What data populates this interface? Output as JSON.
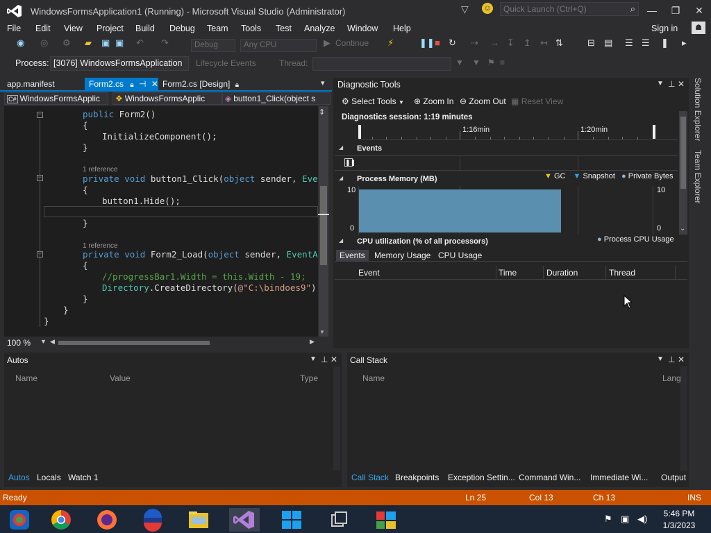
{
  "window": {
    "title": "WindowsFormsApplication1 (Running) - Microsoft Visual Studio (Administrator)",
    "quick_launch_placeholder": "Quick Launch (Ctrl+Q)",
    "minimize": "—",
    "maximize": "❐",
    "close": "✕"
  },
  "menu": {
    "items": [
      "File",
      "Edit",
      "View",
      "Project",
      "Build",
      "Debug",
      "Team",
      "Tools",
      "Test",
      "Analyze",
      "Window",
      "Help"
    ],
    "sign_in": "Sign in"
  },
  "toolbar": {
    "config": "Debug",
    "platform": "Any CPU",
    "continue": "Continue"
  },
  "process_bar": {
    "label": "Process:",
    "process": "[3076] WindowsFormsApplication",
    "lifecycle": "Lifecycle Events",
    "thread_label": "Thread:"
  },
  "editor": {
    "tabs": [
      "app.manifest",
      "Form2.cs",
      "Form2.cs [Design]"
    ],
    "nav": [
      "WindowsFormsApplic",
      "WindowsFormsApplic",
      "button1_Click(object s"
    ],
    "zoom": "100 %",
    "code": {
      "l1_kw": "public",
      "l1_rest": " Form2()",
      "l2": "{",
      "l3": "InitializeComponent();",
      "l4": "}",
      "ref1": "1 reference",
      "l5_kw1": "private",
      "l5_kw2": "void",
      "l5_name": "button1_Click(",
      "l5_kw3": "object",
      "l5_mid": " sender, ",
      "l5_ty": "EventAr",
      "l6": "{",
      "l7": "button1.Hide();",
      "l8": "}",
      "ref2": "1 reference",
      "l9_kw1": "private",
      "l9_kw2": "void",
      "l9_name": "Form2_Load(",
      "l9_kw3": "object",
      "l9_mid": " sender, ",
      "l9_ty": "EventArgs",
      "l10": "{",
      "l11": "//progressBar1.Width = this.Width - 19;",
      "l12_ty": "Directory",
      "l12_mid": ".CreateDirectory(",
      "l12_str": "@\"C:\\bindoes9\"",
      "l12_end": ");",
      "l13": "}",
      "l14": "}",
      "l15": "}"
    }
  },
  "diagnostics": {
    "title": "Diagnostic Tools",
    "select_tools": "Select Tools",
    "zoom_in": "Zoom In",
    "zoom_out": "Zoom Out",
    "reset_view": "Reset View",
    "session": "Diagnostics session: 1:19 minutes",
    "time_labels": [
      "1:16min",
      "1:20min"
    ],
    "events_section": "Events",
    "memory_section": "Process Memory (MB)",
    "memory_legend": [
      "GC",
      "Snapshot",
      "Private Bytes"
    ],
    "memory_y_max": "10",
    "memory_y_min": "0",
    "memory_fill_fraction": 0.69,
    "cpu_section": "CPU utilization (% of all processors)",
    "cpu_legend": "Process CPU Usage",
    "tabs": [
      "Events",
      "Memory Usage",
      "CPU Usage"
    ],
    "columns": [
      "Event",
      "Time",
      "Duration",
      "Thread"
    ],
    "colors": {
      "memory_fill": "#5b8fb0",
      "gc_marker": "#e8c22a",
      "snapshot_marker": "#3aa0e9",
      "private_bytes": "#8ab8d8"
    }
  },
  "autos": {
    "title": "Autos",
    "columns": [
      "Name",
      "Value",
      "Type"
    ],
    "tabs": [
      "Autos",
      "Locals",
      "Watch 1"
    ]
  },
  "callstack": {
    "title": "Call Stack",
    "columns": [
      "Name",
      "Lang"
    ],
    "tabs": [
      "Call Stack",
      "Breakpoints",
      "Exception Settin...",
      "Command Win...",
      "Immediate Wi...",
      "Output"
    ]
  },
  "side_tabs": [
    "Solution Explorer",
    "Team Explorer"
  ],
  "status": {
    "ready": "Ready",
    "ln": "Ln 25",
    "col": "Col 13",
    "ch": "Ch 13",
    "ins": "INS",
    "color": "#ca5100"
  },
  "taskbar": {
    "time": "5:46 PM",
    "date": "1/3/2023"
  }
}
